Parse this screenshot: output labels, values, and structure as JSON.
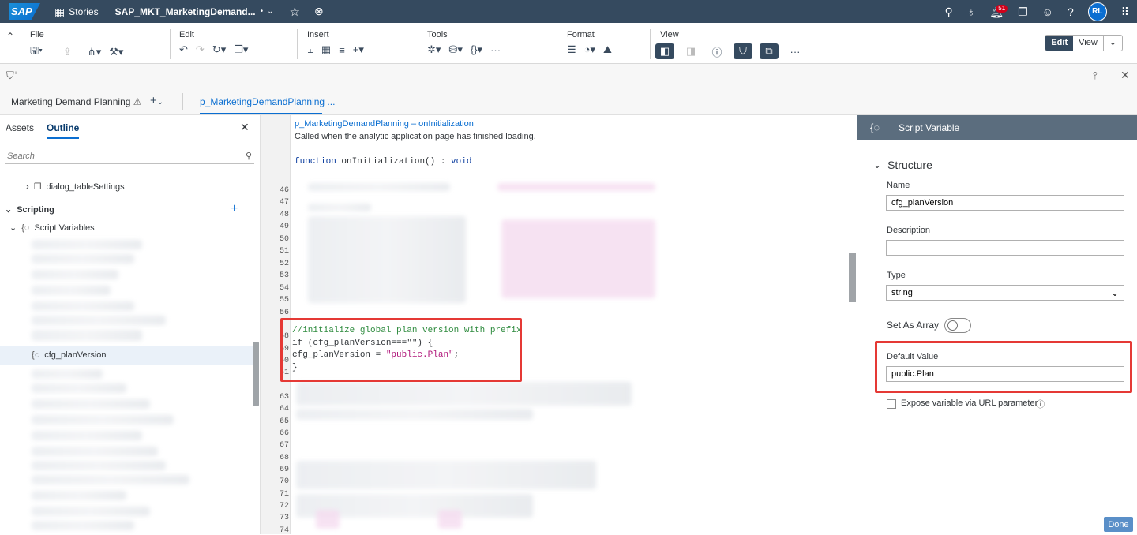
{
  "shell": {
    "logo": "SAP",
    "stories": "Stories",
    "doc_title": "SAP_MKT_MarketingDemand...",
    "notif_count": "51",
    "avatar": "RL"
  },
  "toolbar": {
    "file": "File",
    "edit": "Edit",
    "insert": "Insert",
    "tools": "Tools",
    "format": "Format",
    "view": "View",
    "edit_btn": "Edit",
    "view_btn": "View",
    "more": "···"
  },
  "tabs": {
    "page": "Marketing Demand Planning",
    "script": "p_MarketingDemandPlanning ..."
  },
  "left": {
    "tab_assets": "Assets",
    "tab_outline": "Outline",
    "search_placeholder": "Search",
    "dialog_item": "dialog_tableSettings",
    "scripting": "Scripting",
    "script_vars": "Script Variables",
    "selected_var": "cfg_planVersion"
  },
  "editor": {
    "title": "p_MarketingDemandPlanning – onInitialization",
    "desc": "Called when the analytic application page has finished loading.",
    "fn_kw": "function",
    "fn_name": "onInitialization() : ",
    "fn_ret": "void",
    "line_numbers": [
      "46",
      "47",
      "48",
      "49",
      "50",
      "51",
      "52",
      "53",
      "54",
      "55",
      "56",
      "58",
      "59",
      "60",
      "61",
      "63",
      "64",
      "65",
      "66",
      "67",
      "68",
      "69",
      "70",
      "71",
      "72",
      "73",
      "74"
    ],
    "code_comment": "//initialize global plan version with prefix",
    "code_if": "if (cfg_planVersion===\"\") {",
    "code_assign_a": "cfg_planVersion = ",
    "code_assign_s": "\"public.Plan\"",
    "code_assign_b": ";",
    "code_close": "}"
  },
  "right": {
    "header": "Script Variable",
    "structure": "Structure",
    "name_label": "Name",
    "name_value": "cfg_planVersion",
    "desc_label": "Description",
    "desc_value": "",
    "type_label": "Type",
    "type_value": "string",
    "array_label": "Set As Array",
    "default_label": "Default Value",
    "default_value": "public.Plan",
    "expose_label": "Expose variable via URL parameter",
    "done": "Done"
  }
}
